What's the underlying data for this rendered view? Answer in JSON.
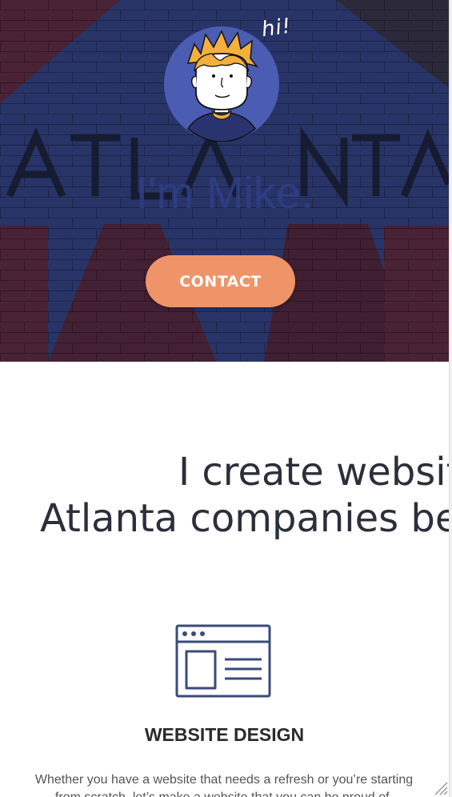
{
  "hero": {
    "greeting": "hi!",
    "title": "I'm Mike.",
    "contact_label": "CONTACT",
    "wall_lettering": "ATLANTA"
  },
  "tagline": {
    "line1": "I create websit",
    "line2": "Atlanta companies be"
  },
  "service": {
    "icon": "website-layout-icon",
    "title": "WEBSITE DESIGN",
    "description": "Whether you have a website that needs a refresh or you’re starting from scratch, let’s make a website that you can be proud of."
  },
  "colors": {
    "accent": "#ee9468",
    "avatar_bg": "#4b5cb3",
    "hero_text": "#2f3f8a",
    "icon_stroke": "#3a4a7a"
  }
}
